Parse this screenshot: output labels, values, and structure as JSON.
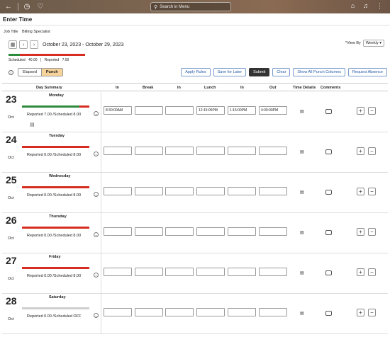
{
  "header": {
    "search_placeholder": "Search in Menu"
  },
  "page": {
    "title": "Enter Time"
  },
  "job": {
    "label": "Job Title",
    "value": "Billing Specialist"
  },
  "period": {
    "range": "October 23, 2023 - October 29, 2023"
  },
  "view_by": {
    "label": "*View By",
    "value": "Weekly"
  },
  "summary": {
    "scheduled_label": "Scheduled",
    "scheduled_value": "40.00",
    "reported_label": "Reported",
    "reported_value": "7.00"
  },
  "mode": {
    "options": [
      "Elapsed",
      "Punch"
    ],
    "selected": "Punch"
  },
  "actions": [
    "Apply Rules",
    "Save for Later",
    "Submit",
    "Clear",
    "Show All Punch Columns",
    "Request Absence"
  ],
  "columns": [
    "Day Summary",
    "In",
    "Break",
    "In",
    "Lunch",
    "In",
    "Out",
    "Time Details",
    "Comments"
  ],
  "colors": {
    "green": "#2e8b3d",
    "red": "#d62d20",
    "gray": "#cfcfcf"
  },
  "days": [
    {
      "num": "23",
      "mon": "Oct",
      "name": "Monday",
      "summary": "Reported 7.00 /Scheduled 8.00",
      "progress": 0.85,
      "punches": [
        "8:30:00AM",
        "",
        "",
        "12:15:00PM",
        "1:15:00PM",
        "4:30:00PM"
      ]
    },
    {
      "num": "24",
      "mon": "Oct",
      "name": "Tuesday",
      "summary": "Reported 0.00 /Scheduled 8.00",
      "progress": 0,
      "punches": [
        "",
        "",
        "",
        "",
        "",
        ""
      ]
    },
    {
      "num": "25",
      "mon": "Oct",
      "name": "Wednesday",
      "summary": "Reported 0.00 /Scheduled 8.00",
      "progress": 0,
      "punches": [
        "",
        "",
        "",
        "",
        "",
        ""
      ]
    },
    {
      "num": "26",
      "mon": "Oct",
      "name": "Thursday",
      "summary": "Reported 0.00 /Scheduled 8.00",
      "progress": 0,
      "punches": [
        "",
        "",
        "",
        "",
        "",
        ""
      ]
    },
    {
      "num": "27",
      "mon": "Oct",
      "name": "Friday",
      "summary": "Reported 0.00 /Scheduled 8.00",
      "progress": 0,
      "punches": [
        "",
        "",
        "",
        "",
        "",
        ""
      ]
    },
    {
      "num": "28",
      "mon": "Oct",
      "name": "Saturday",
      "summary": "Reported 0.00 /Scheduled OFF",
      "progress": 0,
      "punches": [
        "",
        "",
        "",
        "",
        "",
        ""
      ]
    }
  ]
}
